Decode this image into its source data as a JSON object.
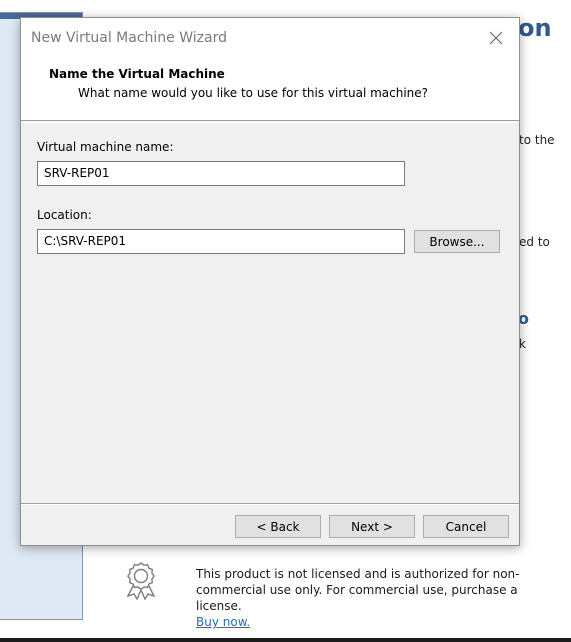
{
  "background": {
    "fragments": {
      "on": "on",
      "to_the": "to the",
      "ed_to": "ed to",
      "o": "o",
      "k": "k"
    },
    "license": {
      "text": "This product is not licensed and is authorized for non-commercial use only. For commercial use, purchase a license.",
      "link": "Buy now."
    }
  },
  "dialog": {
    "title": "New Virtual Machine Wizard",
    "close_icon": "close-icon",
    "header": {
      "title": "Name the Virtual Machine",
      "subtitle": "What name would you like to use for this virtual machine?"
    },
    "form": {
      "name_label": "Virtual machine name:",
      "name_value": "SRV-REP01",
      "location_label": "Location:",
      "location_value": "C:\\SRV-REP01",
      "browse_label": "Browse..."
    },
    "footer": {
      "back_label": "< Back",
      "next_label": "Next >",
      "cancel_label": "Cancel"
    }
  },
  "colors": {
    "accent_title": "#2e5a8c",
    "link": "#1a6fbf",
    "dialog_bg": "#f0f0f0"
  }
}
